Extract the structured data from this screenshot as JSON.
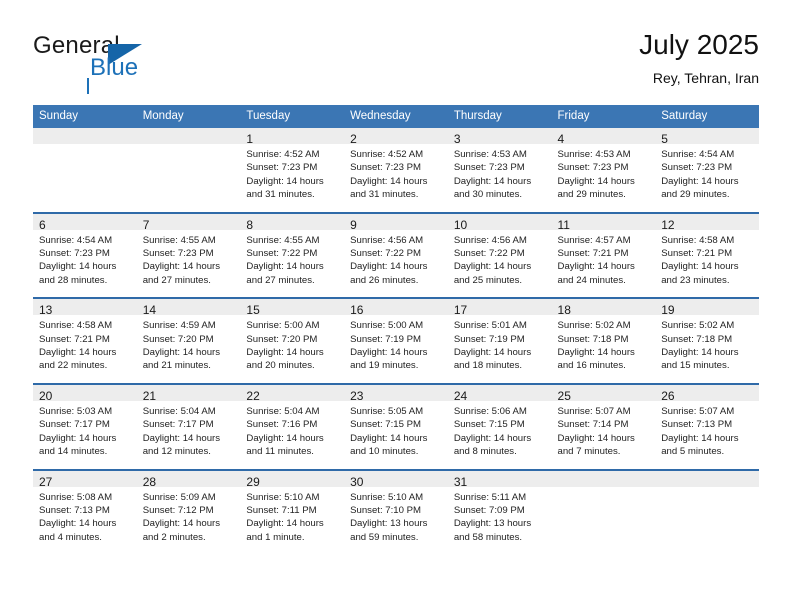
{
  "brand": {
    "name_top": "General",
    "name_bottom": "Blue",
    "logo_color": "#1d71b8"
  },
  "header": {
    "title": "July 2025",
    "subtitle": "Rey, Tehran, Iran"
  },
  "theme": {
    "header_blue": "#3b76b4",
    "separator_blue": "#2f6aa8",
    "daynum_gray": "#ededed"
  },
  "weekday_headers": [
    "Sunday",
    "Monday",
    "Tuesday",
    "Wednesday",
    "Thursday",
    "Friday",
    "Saturday"
  ],
  "weeks": [
    [
      {
        "day": "",
        "empty": true,
        "sunrise": "",
        "sunset": "",
        "daylight": ""
      },
      {
        "day": "",
        "empty": true,
        "sunrise": "",
        "sunset": "",
        "daylight": ""
      },
      {
        "day": "1",
        "empty": false,
        "sunrise": "Sunrise: 4:52 AM",
        "sunset": "Sunset: 7:23 PM",
        "daylight": "Daylight: 14 hours and 31 minutes."
      },
      {
        "day": "2",
        "empty": false,
        "sunrise": "Sunrise: 4:52 AM",
        "sunset": "Sunset: 7:23 PM",
        "daylight": "Daylight: 14 hours and 31 minutes."
      },
      {
        "day": "3",
        "empty": false,
        "sunrise": "Sunrise: 4:53 AM",
        "sunset": "Sunset: 7:23 PM",
        "daylight": "Daylight: 14 hours and 30 minutes."
      },
      {
        "day": "4",
        "empty": false,
        "sunrise": "Sunrise: 4:53 AM",
        "sunset": "Sunset: 7:23 PM",
        "daylight": "Daylight: 14 hours and 29 minutes."
      },
      {
        "day": "5",
        "empty": false,
        "sunrise": "Sunrise: 4:54 AM",
        "sunset": "Sunset: 7:23 PM",
        "daylight": "Daylight: 14 hours and 29 minutes."
      }
    ],
    [
      {
        "day": "6",
        "empty": false,
        "sunrise": "Sunrise: 4:54 AM",
        "sunset": "Sunset: 7:23 PM",
        "daylight": "Daylight: 14 hours and 28 minutes."
      },
      {
        "day": "7",
        "empty": false,
        "sunrise": "Sunrise: 4:55 AM",
        "sunset": "Sunset: 7:23 PM",
        "daylight": "Daylight: 14 hours and 27 minutes."
      },
      {
        "day": "8",
        "empty": false,
        "sunrise": "Sunrise: 4:55 AM",
        "sunset": "Sunset: 7:22 PM",
        "daylight": "Daylight: 14 hours and 27 minutes."
      },
      {
        "day": "9",
        "empty": false,
        "sunrise": "Sunrise: 4:56 AM",
        "sunset": "Sunset: 7:22 PM",
        "daylight": "Daylight: 14 hours and 26 minutes."
      },
      {
        "day": "10",
        "empty": false,
        "sunrise": "Sunrise: 4:56 AM",
        "sunset": "Sunset: 7:22 PM",
        "daylight": "Daylight: 14 hours and 25 minutes."
      },
      {
        "day": "11",
        "empty": false,
        "sunrise": "Sunrise: 4:57 AM",
        "sunset": "Sunset: 7:21 PM",
        "daylight": "Daylight: 14 hours and 24 minutes."
      },
      {
        "day": "12",
        "empty": false,
        "sunrise": "Sunrise: 4:58 AM",
        "sunset": "Sunset: 7:21 PM",
        "daylight": "Daylight: 14 hours and 23 minutes."
      }
    ],
    [
      {
        "day": "13",
        "empty": false,
        "sunrise": "Sunrise: 4:58 AM",
        "sunset": "Sunset: 7:21 PM",
        "daylight": "Daylight: 14 hours and 22 minutes."
      },
      {
        "day": "14",
        "empty": false,
        "sunrise": "Sunrise: 4:59 AM",
        "sunset": "Sunset: 7:20 PM",
        "daylight": "Daylight: 14 hours and 21 minutes."
      },
      {
        "day": "15",
        "empty": false,
        "sunrise": "Sunrise: 5:00 AM",
        "sunset": "Sunset: 7:20 PM",
        "daylight": "Daylight: 14 hours and 20 minutes."
      },
      {
        "day": "16",
        "empty": false,
        "sunrise": "Sunrise: 5:00 AM",
        "sunset": "Sunset: 7:19 PM",
        "daylight": "Daylight: 14 hours and 19 minutes."
      },
      {
        "day": "17",
        "empty": false,
        "sunrise": "Sunrise: 5:01 AM",
        "sunset": "Sunset: 7:19 PM",
        "daylight": "Daylight: 14 hours and 18 minutes."
      },
      {
        "day": "18",
        "empty": false,
        "sunrise": "Sunrise: 5:02 AM",
        "sunset": "Sunset: 7:18 PM",
        "daylight": "Daylight: 14 hours and 16 minutes."
      },
      {
        "day": "19",
        "empty": false,
        "sunrise": "Sunrise: 5:02 AM",
        "sunset": "Sunset: 7:18 PM",
        "daylight": "Daylight: 14 hours and 15 minutes."
      }
    ],
    [
      {
        "day": "20",
        "empty": false,
        "sunrise": "Sunrise: 5:03 AM",
        "sunset": "Sunset: 7:17 PM",
        "daylight": "Daylight: 14 hours and 14 minutes."
      },
      {
        "day": "21",
        "empty": false,
        "sunrise": "Sunrise: 5:04 AM",
        "sunset": "Sunset: 7:17 PM",
        "daylight": "Daylight: 14 hours and 12 minutes."
      },
      {
        "day": "22",
        "empty": false,
        "sunrise": "Sunrise: 5:04 AM",
        "sunset": "Sunset: 7:16 PM",
        "daylight": "Daylight: 14 hours and 11 minutes."
      },
      {
        "day": "23",
        "empty": false,
        "sunrise": "Sunrise: 5:05 AM",
        "sunset": "Sunset: 7:15 PM",
        "daylight": "Daylight: 14 hours and 10 minutes."
      },
      {
        "day": "24",
        "empty": false,
        "sunrise": "Sunrise: 5:06 AM",
        "sunset": "Sunset: 7:15 PM",
        "daylight": "Daylight: 14 hours and 8 minutes."
      },
      {
        "day": "25",
        "empty": false,
        "sunrise": "Sunrise: 5:07 AM",
        "sunset": "Sunset: 7:14 PM",
        "daylight": "Daylight: 14 hours and 7 minutes."
      },
      {
        "day": "26",
        "empty": false,
        "sunrise": "Sunrise: 5:07 AM",
        "sunset": "Sunset: 7:13 PM",
        "daylight": "Daylight: 14 hours and 5 minutes."
      }
    ],
    [
      {
        "day": "27",
        "empty": false,
        "sunrise": "Sunrise: 5:08 AM",
        "sunset": "Sunset: 7:13 PM",
        "daylight": "Daylight: 14 hours and 4 minutes."
      },
      {
        "day": "28",
        "empty": false,
        "sunrise": "Sunrise: 5:09 AM",
        "sunset": "Sunset: 7:12 PM",
        "daylight": "Daylight: 14 hours and 2 minutes."
      },
      {
        "day": "29",
        "empty": false,
        "sunrise": "Sunrise: 5:10 AM",
        "sunset": "Sunset: 7:11 PM",
        "daylight": "Daylight: 14 hours and 1 minute."
      },
      {
        "day": "30",
        "empty": false,
        "sunrise": "Sunrise: 5:10 AM",
        "sunset": "Sunset: 7:10 PM",
        "daylight": "Daylight: 13 hours and 59 minutes."
      },
      {
        "day": "31",
        "empty": false,
        "sunrise": "Sunrise: 5:11 AM",
        "sunset": "Sunset: 7:09 PM",
        "daylight": "Daylight: 13 hours and 58 minutes."
      },
      {
        "day": "",
        "empty": true,
        "sunrise": "",
        "sunset": "",
        "daylight": ""
      },
      {
        "day": "",
        "empty": true,
        "sunrise": "",
        "sunset": "",
        "daylight": ""
      }
    ]
  ]
}
